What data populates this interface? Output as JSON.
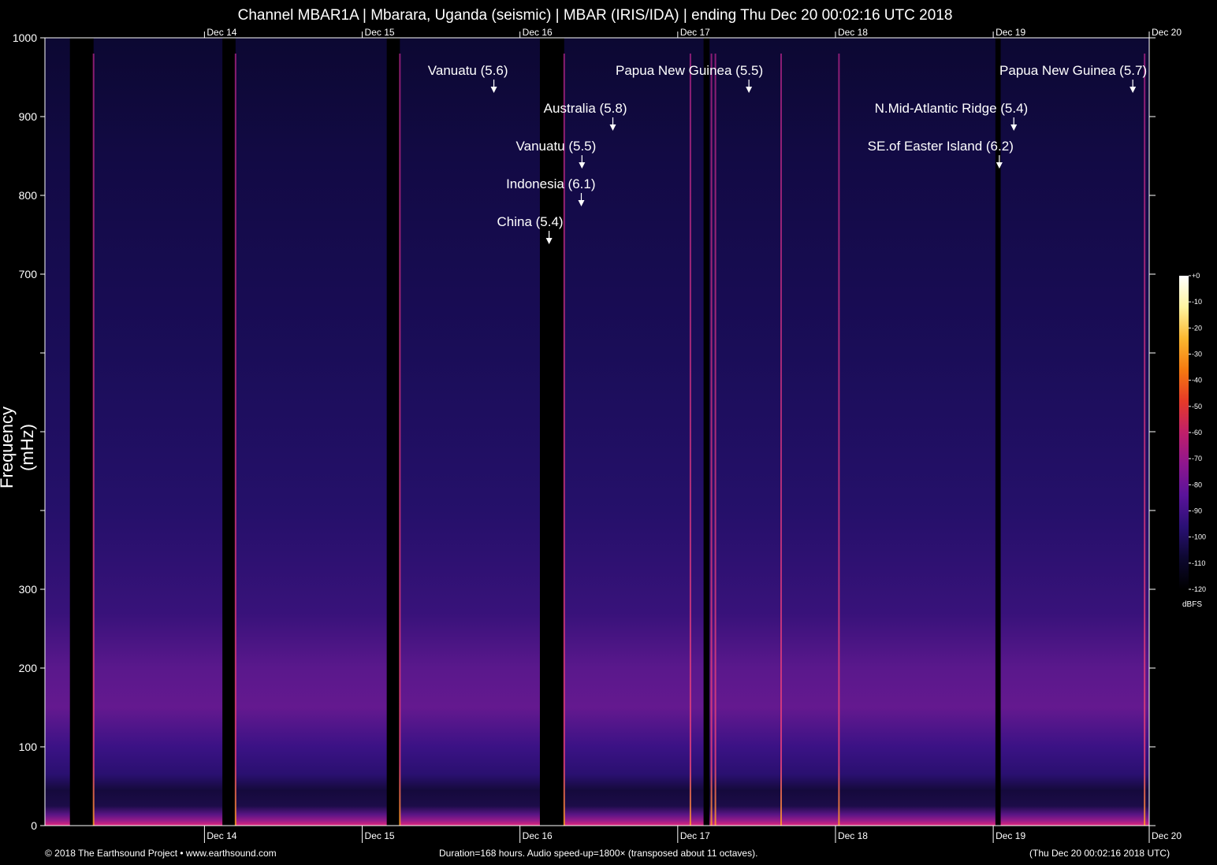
{
  "header": {
    "title": "Channel MBAR1A | Mbarara, Uganda (seismic) | MBAR (IRIS/IDA) | ending Thu Dec 20 00:02:16 UTC 2018"
  },
  "footer": {
    "copyright": "© 2018 The Earthsound Project • www.earthsound.com",
    "duration": "Duration=168 hours. Audio speed-up=1800× (transposed about 11 octaves).",
    "end_time": "(Thu Dec 20 00:02:16 2018 UTC)"
  },
  "colorbar": {
    "unit": "dBFS",
    "ticks": [
      "+0",
      "-10",
      "-20",
      "-30",
      "-40",
      "-50",
      "-60",
      "-70",
      "-80",
      "-90",
      "-100",
      "-110",
      "-120"
    ],
    "colors": [
      "#000000",
      "#0d0830",
      "#2a1075",
      "#5a139a",
      "#8e168e",
      "#c01f6a",
      "#e63a28",
      "#f57a10",
      "#fbb830",
      "#fff4a0",
      "#ffffff"
    ]
  },
  "chart_data": {
    "type": "heatmap",
    "title": "Channel MBAR1A | Mbarara, Uganda (seismic) | MBAR (IRIS/IDA) | ending Thu Dec 20 00:02:16 UTC 2018",
    "xlabel": "",
    "ylabel": "Frequency (mHz)",
    "x_unit": "hours",
    "xlim": [
      0,
      168
    ],
    "ylim": [
      0,
      1000
    ],
    "x_ticks": [
      {
        "x": 24.27,
        "label": "Dec 14"
      },
      {
        "x": 48.27,
        "label": "Dec 15"
      },
      {
        "x": 72.27,
        "label": "Dec 16"
      },
      {
        "x": 96.27,
        "label": "Dec 17"
      },
      {
        "x": 120.27,
        "label": "Dec 18"
      },
      {
        "x": 144.27,
        "label": "Dec 19"
      },
      {
        "x": 168.0,
        "label": "Dec 20"
      }
    ],
    "y_ticks": [
      {
        "y": 0,
        "label": "0"
      },
      {
        "y": 100,
        "label": "100"
      },
      {
        "y": 200,
        "label": "200"
      },
      {
        "y": 300,
        "label": "300"
      },
      {
        "y": 400,
        "label": ""
      },
      {
        "y": 500,
        "label": ""
      },
      {
        "y": 600,
        "label": ""
      },
      {
        "y": 700,
        "label": "700"
      },
      {
        "y": 800,
        "label": "800"
      },
      {
        "y": 900,
        "label": "900"
      },
      {
        "y": 1000,
        "label": "1000"
      }
    ],
    "data_gaps_hours": [
      [
        3.8,
        7.4
      ],
      [
        27.0,
        29.0
      ],
      [
        52.0,
        54.0
      ],
      [
        75.3,
        79.0
      ],
      [
        100.2,
        101.1
      ],
      [
        144.6,
        145.4
      ]
    ],
    "broadband_spikes_hours": [
      7.4,
      29.0,
      54.0,
      79.0,
      98.2,
      101.4,
      102.0,
      112.0,
      120.8,
      167.3
    ],
    "events": [
      {
        "label": "Vanuatu (5.6)",
        "x": 68.3,
        "y": 933
      },
      {
        "label": "Australia (5.8)",
        "x": 86.4,
        "y": 885
      },
      {
        "label": "Vanuatu (5.5)",
        "x": 81.7,
        "y": 837
      },
      {
        "label": "Indonesia (6.1)",
        "x": 81.6,
        "y": 789
      },
      {
        "label": "China (5.4)",
        "x": 76.7,
        "y": 741
      },
      {
        "label": "Papua New Guinea (5.5)",
        "x": 107.1,
        "y": 933
      },
      {
        "label": "N.Mid-Atlantic Ridge (5.4)",
        "x": 147.4,
        "y": 885
      },
      {
        "label": "SE.of Easter Island (6.2)",
        "x": 145.2,
        "y": 837
      },
      {
        "label": "Papua New Guinea (5.7)",
        "x": 165.5,
        "y": 933
      }
    ]
  }
}
